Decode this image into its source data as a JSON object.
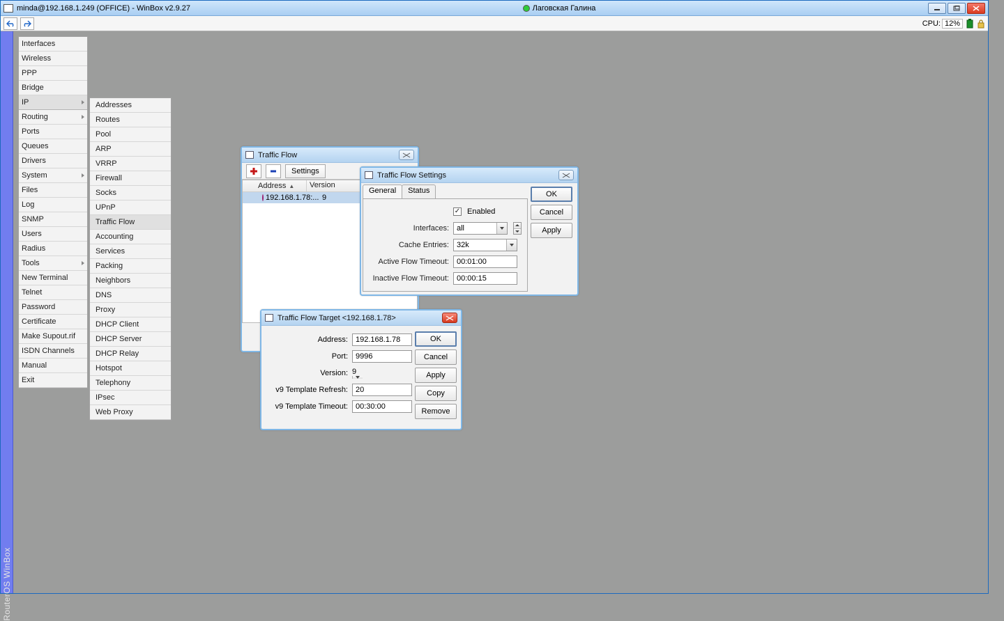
{
  "titlebar": {
    "title": "minda@192.168.1.249 (OFFICE) - WinBox v2.9.27",
    "presence_name": "Лаговская Галина"
  },
  "toolbar": {
    "cpu_label": "CPU:",
    "cpu_value": "12%"
  },
  "leftStripe": "RouterOS WinBox",
  "mainMenu": [
    {
      "label": "Interfaces"
    },
    {
      "label": "Wireless"
    },
    {
      "label": "PPP"
    },
    {
      "label": "Bridge"
    },
    {
      "label": "IP",
      "sub": true,
      "sel": true
    },
    {
      "label": "Routing",
      "sub": true
    },
    {
      "label": "Ports"
    },
    {
      "label": "Queues"
    },
    {
      "label": "Drivers"
    },
    {
      "label": "System",
      "sub": true
    },
    {
      "label": "Files"
    },
    {
      "label": "Log"
    },
    {
      "label": "SNMP"
    },
    {
      "label": "Users"
    },
    {
      "label": "Radius"
    },
    {
      "label": "Tools",
      "sub": true
    },
    {
      "label": "New Terminal"
    },
    {
      "label": "Telnet"
    },
    {
      "label": "Password"
    },
    {
      "label": "Certificate"
    },
    {
      "label": "Make Supout.rif"
    },
    {
      "label": "ISDN Channels"
    },
    {
      "label": "Manual"
    },
    {
      "label": "Exit"
    }
  ],
  "ipSubmenu": [
    "Addresses",
    "Routes",
    "Pool",
    "ARP",
    "VRRP",
    "Firewall",
    "Socks",
    "UPnP",
    "Traffic Flow",
    "Accounting",
    "Services",
    "Packing",
    "Neighbors",
    "DNS",
    "Proxy",
    "DHCP Client",
    "DHCP Server",
    "DHCP Relay",
    "Hotspot",
    "Telephony",
    "IPsec",
    "Web Proxy"
  ],
  "tfWin": {
    "title": "Traffic Flow",
    "settingsBtn": "Settings",
    "col_address": "Address",
    "col_version": "Version",
    "row_addr": "192.168.1.78:...",
    "row_ver": "9"
  },
  "tfSettings": {
    "title": "Traffic Flow Settings",
    "tab_general": "General",
    "tab_status": "Status",
    "enabled": "Enabled",
    "interfaces_lbl": "Interfaces:",
    "interfaces_val": "all",
    "cache_lbl": "Cache Entries:",
    "cache_val": "32k",
    "active_lbl": "Active Flow Timeout:",
    "active_val": "00:01:00",
    "inactive_lbl": "Inactive Flow Timeout:",
    "inactive_val": "00:00:15",
    "btn_ok": "OK",
    "btn_cancel": "Cancel",
    "btn_apply": "Apply"
  },
  "tfTarget": {
    "title": "Traffic Flow Target <192.168.1.78>",
    "addr_lbl": "Address:",
    "addr_val": "192.168.1.78",
    "port_lbl": "Port:",
    "port_val": "9996",
    "version_lbl": "Version:",
    "version_val": "9",
    "refresh_lbl": "v9 Template Refresh:",
    "refresh_val": "20",
    "timeout_lbl": "v9 Template Timeout:",
    "timeout_val": "00:30:00",
    "btn_ok": "OK",
    "btn_cancel": "Cancel",
    "btn_apply": "Apply",
    "btn_copy": "Copy",
    "btn_remove": "Remove"
  }
}
